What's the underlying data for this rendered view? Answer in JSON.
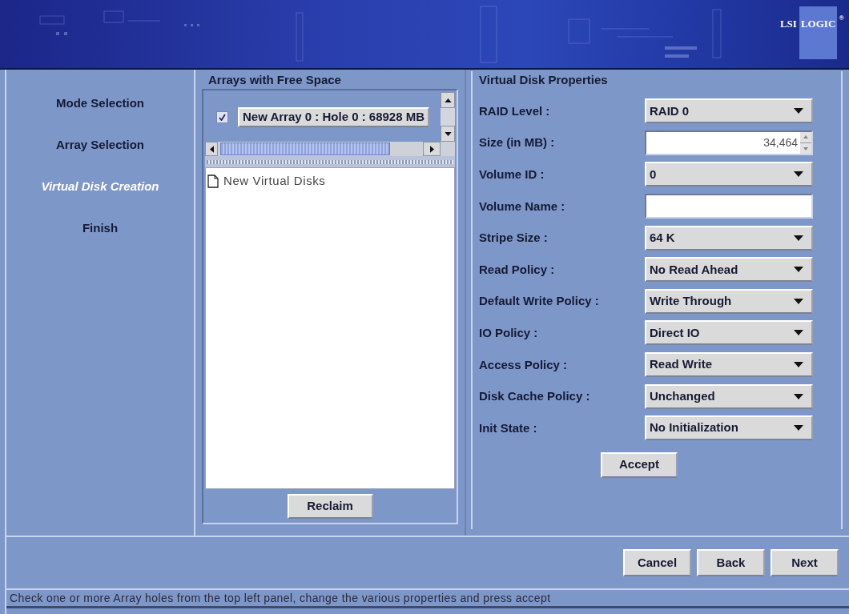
{
  "header": {
    "logo": {
      "left": "LSI",
      "right": "LOGIC",
      "mark": "®"
    }
  },
  "steps": [
    {
      "label": "Mode Selection",
      "selected": false
    },
    {
      "label": "Array Selection",
      "selected": false
    },
    {
      "label": "Virtual Disk Creation",
      "selected": true
    },
    {
      "label": "Finish",
      "selected": false
    }
  ],
  "arrays_panel": {
    "title": "Arrays with Free Space",
    "holes": [
      {
        "label": "New Array 0 : Hole 0 : 68928 MB",
        "checked": true
      }
    ],
    "tree": [
      {
        "label": "New Virtual Disks"
      }
    ],
    "reclaim_button": "Reclaim"
  },
  "properties": {
    "title": "Virtual Disk Properties",
    "fields": [
      {
        "label": "RAID Level :",
        "kind": "dropdown",
        "value": "RAID 0"
      },
      {
        "label": "Size (in MB) :",
        "kind": "spinner",
        "value": "34,464"
      },
      {
        "label": "Volume ID :",
        "kind": "dropdown",
        "value": "0"
      },
      {
        "label": "Volume Name :",
        "kind": "text"
      },
      {
        "label": "Stripe Size :",
        "kind": "dropdown",
        "value": "64 K"
      },
      {
        "label": "Read Policy :",
        "kind": "dropdown",
        "value": "No Read Ahead"
      },
      {
        "label": "Default Write Policy :",
        "kind": "dropdown",
        "value": "Write Through"
      },
      {
        "label": "IO Policy :",
        "kind": "dropdown",
        "value": "Direct IO"
      },
      {
        "label": "Access Policy :",
        "kind": "dropdown",
        "value": "Read Write"
      },
      {
        "label": "Disk Cache Policy :",
        "kind": "dropdown",
        "value": "Unchanged"
      },
      {
        "label": "Init State :",
        "kind": "dropdown",
        "value": "No Initialization"
      }
    ],
    "accept_button": "Accept"
  },
  "buttons": [
    "Cancel",
    "Back",
    "Next"
  ],
  "status_bar": "Check one or more Array holes from the top left panel, change the various properties and press accept"
}
